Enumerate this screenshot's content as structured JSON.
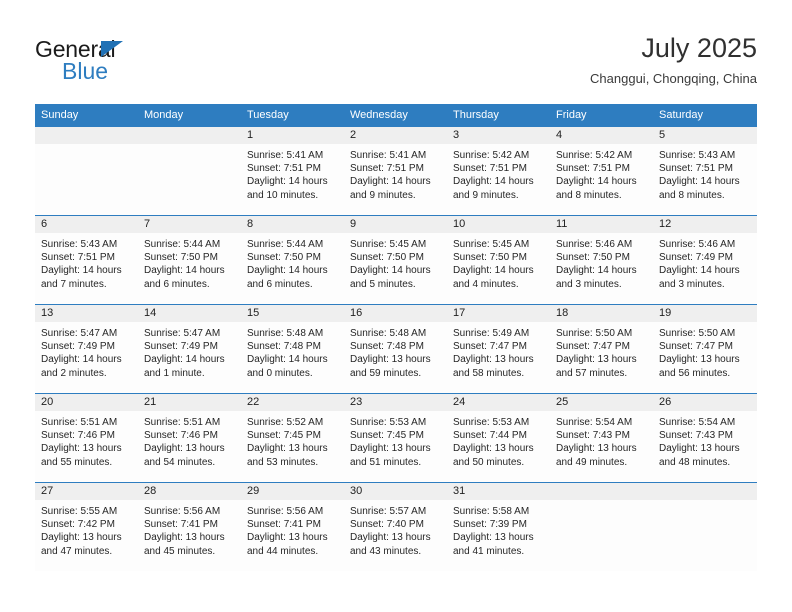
{
  "brand": {
    "name_top": "General",
    "name_bottom": "Blue",
    "triangle_color": "#2071b5",
    "text_color": "#2e7dc0"
  },
  "header": {
    "title": "July 2025",
    "subtitle": "Changgui, Chongqing, China"
  },
  "theme": {
    "header_blue": "#2e7dc0",
    "daynum_band": "#efefef",
    "cell_bg": "#fdfdfd",
    "text": "#262626"
  },
  "weekday_headers": [
    "Sunday",
    "Monday",
    "Tuesday",
    "Wednesday",
    "Thursday",
    "Friday",
    "Saturday"
  ],
  "labels": {
    "sunrise": "Sunrise:",
    "sunset": "Sunset:",
    "daylight": "Daylight:"
  },
  "weeks": [
    [
      {
        "day": "",
        "empty": true
      },
      {
        "day": "",
        "empty": true
      },
      {
        "day": "1",
        "sunrise": "Sunrise: 5:41 AM",
        "sunset": "Sunset: 7:51 PM",
        "daylight_l1": "Daylight: 14 hours",
        "daylight_l2": "and 10 minutes."
      },
      {
        "day": "2",
        "sunrise": "Sunrise: 5:41 AM",
        "sunset": "Sunset: 7:51 PM",
        "daylight_l1": "Daylight: 14 hours",
        "daylight_l2": "and 9 minutes."
      },
      {
        "day": "3",
        "sunrise": "Sunrise: 5:42 AM",
        "sunset": "Sunset: 7:51 PM",
        "daylight_l1": "Daylight: 14 hours",
        "daylight_l2": "and 9 minutes."
      },
      {
        "day": "4",
        "sunrise": "Sunrise: 5:42 AM",
        "sunset": "Sunset: 7:51 PM",
        "daylight_l1": "Daylight: 14 hours",
        "daylight_l2": "and 8 minutes."
      },
      {
        "day": "5",
        "sunrise": "Sunrise: 5:43 AM",
        "sunset": "Sunset: 7:51 PM",
        "daylight_l1": "Daylight: 14 hours",
        "daylight_l2": "and 8 minutes."
      }
    ],
    [
      {
        "day": "6",
        "sunrise": "Sunrise: 5:43 AM",
        "sunset": "Sunset: 7:51 PM",
        "daylight_l1": "Daylight: 14 hours",
        "daylight_l2": "and 7 minutes."
      },
      {
        "day": "7",
        "sunrise": "Sunrise: 5:44 AM",
        "sunset": "Sunset: 7:50 PM",
        "daylight_l1": "Daylight: 14 hours",
        "daylight_l2": "and 6 minutes."
      },
      {
        "day": "8",
        "sunrise": "Sunrise: 5:44 AM",
        "sunset": "Sunset: 7:50 PM",
        "daylight_l1": "Daylight: 14 hours",
        "daylight_l2": "and 6 minutes."
      },
      {
        "day": "9",
        "sunrise": "Sunrise: 5:45 AM",
        "sunset": "Sunset: 7:50 PM",
        "daylight_l1": "Daylight: 14 hours",
        "daylight_l2": "and 5 minutes."
      },
      {
        "day": "10",
        "sunrise": "Sunrise: 5:45 AM",
        "sunset": "Sunset: 7:50 PM",
        "daylight_l1": "Daylight: 14 hours",
        "daylight_l2": "and 4 minutes."
      },
      {
        "day": "11",
        "sunrise": "Sunrise: 5:46 AM",
        "sunset": "Sunset: 7:50 PM",
        "daylight_l1": "Daylight: 14 hours",
        "daylight_l2": "and 3 minutes."
      },
      {
        "day": "12",
        "sunrise": "Sunrise: 5:46 AM",
        "sunset": "Sunset: 7:49 PM",
        "daylight_l1": "Daylight: 14 hours",
        "daylight_l2": "and 3 minutes."
      }
    ],
    [
      {
        "day": "13",
        "sunrise": "Sunrise: 5:47 AM",
        "sunset": "Sunset: 7:49 PM",
        "daylight_l1": "Daylight: 14 hours",
        "daylight_l2": "and 2 minutes."
      },
      {
        "day": "14",
        "sunrise": "Sunrise: 5:47 AM",
        "sunset": "Sunset: 7:49 PM",
        "daylight_l1": "Daylight: 14 hours",
        "daylight_l2": "and 1 minute."
      },
      {
        "day": "15",
        "sunrise": "Sunrise: 5:48 AM",
        "sunset": "Sunset: 7:48 PM",
        "daylight_l1": "Daylight: 14 hours",
        "daylight_l2": "and 0 minutes."
      },
      {
        "day": "16",
        "sunrise": "Sunrise: 5:48 AM",
        "sunset": "Sunset: 7:48 PM",
        "daylight_l1": "Daylight: 13 hours",
        "daylight_l2": "and 59 minutes."
      },
      {
        "day": "17",
        "sunrise": "Sunrise: 5:49 AM",
        "sunset": "Sunset: 7:47 PM",
        "daylight_l1": "Daylight: 13 hours",
        "daylight_l2": "and 58 minutes."
      },
      {
        "day": "18",
        "sunrise": "Sunrise: 5:50 AM",
        "sunset": "Sunset: 7:47 PM",
        "daylight_l1": "Daylight: 13 hours",
        "daylight_l2": "and 57 minutes."
      },
      {
        "day": "19",
        "sunrise": "Sunrise: 5:50 AM",
        "sunset": "Sunset: 7:47 PM",
        "daylight_l1": "Daylight: 13 hours",
        "daylight_l2": "and 56 minutes."
      }
    ],
    [
      {
        "day": "20",
        "sunrise": "Sunrise: 5:51 AM",
        "sunset": "Sunset: 7:46 PM",
        "daylight_l1": "Daylight: 13 hours",
        "daylight_l2": "and 55 minutes."
      },
      {
        "day": "21",
        "sunrise": "Sunrise: 5:51 AM",
        "sunset": "Sunset: 7:46 PM",
        "daylight_l1": "Daylight: 13 hours",
        "daylight_l2": "and 54 minutes."
      },
      {
        "day": "22",
        "sunrise": "Sunrise: 5:52 AM",
        "sunset": "Sunset: 7:45 PM",
        "daylight_l1": "Daylight: 13 hours",
        "daylight_l2": "and 53 minutes."
      },
      {
        "day": "23",
        "sunrise": "Sunrise: 5:53 AM",
        "sunset": "Sunset: 7:45 PM",
        "daylight_l1": "Daylight: 13 hours",
        "daylight_l2": "and 51 minutes."
      },
      {
        "day": "24",
        "sunrise": "Sunrise: 5:53 AM",
        "sunset": "Sunset: 7:44 PM",
        "daylight_l1": "Daylight: 13 hours",
        "daylight_l2": "and 50 minutes."
      },
      {
        "day": "25",
        "sunrise": "Sunrise: 5:54 AM",
        "sunset": "Sunset: 7:43 PM",
        "daylight_l1": "Daylight: 13 hours",
        "daylight_l2": "and 49 minutes."
      },
      {
        "day": "26",
        "sunrise": "Sunrise: 5:54 AM",
        "sunset": "Sunset: 7:43 PM",
        "daylight_l1": "Daylight: 13 hours",
        "daylight_l2": "and 48 minutes."
      }
    ],
    [
      {
        "day": "27",
        "sunrise": "Sunrise: 5:55 AM",
        "sunset": "Sunset: 7:42 PM",
        "daylight_l1": "Daylight: 13 hours",
        "daylight_l2": "and 47 minutes."
      },
      {
        "day": "28",
        "sunrise": "Sunrise: 5:56 AM",
        "sunset": "Sunset: 7:41 PM",
        "daylight_l1": "Daylight: 13 hours",
        "daylight_l2": "and 45 minutes."
      },
      {
        "day": "29",
        "sunrise": "Sunrise: 5:56 AM",
        "sunset": "Sunset: 7:41 PM",
        "daylight_l1": "Daylight: 13 hours",
        "daylight_l2": "and 44 minutes."
      },
      {
        "day": "30",
        "sunrise": "Sunrise: 5:57 AM",
        "sunset": "Sunset: 7:40 PM",
        "daylight_l1": "Daylight: 13 hours",
        "daylight_l2": "and 43 minutes."
      },
      {
        "day": "31",
        "sunrise": "Sunrise: 5:58 AM",
        "sunset": "Sunset: 7:39 PM",
        "daylight_l1": "Daylight: 13 hours",
        "daylight_l2": "and 41 minutes."
      },
      {
        "day": "",
        "empty": true
      },
      {
        "day": "",
        "empty": true
      }
    ]
  ]
}
